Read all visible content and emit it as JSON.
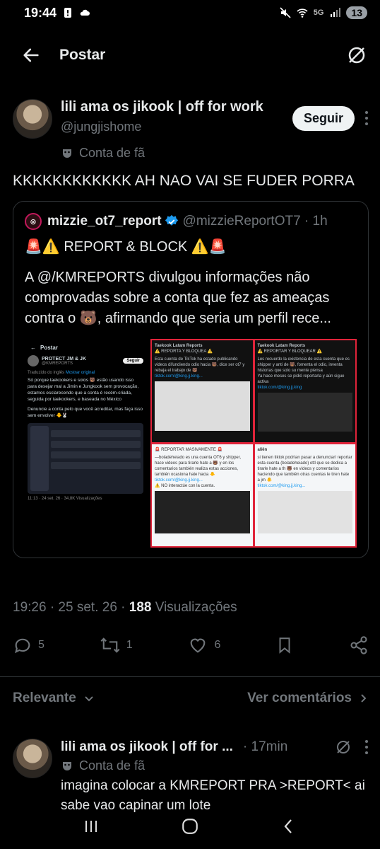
{
  "status_bar": {
    "time": "19:44",
    "battery": "13",
    "network": "5G"
  },
  "header": {
    "title": "Postar"
  },
  "post": {
    "author_name": "lili ama os jikook | off for work",
    "author_handle": "@jungjishome",
    "follow_label": "Seguir",
    "fan_label": "Conta de fã",
    "text": "KKKKKKKKKKKK AH NAO VAI SE FUDER PORRA",
    "timestamp": "19:26 · 25 set. 26 · ",
    "views_count": "188",
    "views_label": " Visualizações"
  },
  "quote": {
    "name": "mizzie_ot7_report",
    "handle": "@mizzieReportOT7 · 1h",
    "line1": "🚨⚠️ REPORT & BLOCK ⚠️🚨",
    "line2": "A @/KMREPORTS divulgou informações não comprovadas sobre a conta que fez as ameaças contra o 🐻, afirmando que seria um perfil rece...",
    "media": {
      "left_title": "Postar",
      "left_account": "PROTECT JM & JK",
      "left_handle": "@KMREPORTS",
      "left_follow": "Seguir",
      "left_translated": "Traduzido do inglês",
      "left_show_original": "Mostrar original",
      "left_body": "Só porque taekookers e solos 🐻 estão usando isso para desejar mal a Jimin e Jungkook sem provocação, estamos esclarecendo que a conta é recém-criada, seguida por taekookers, e baseada no México",
      "left_body2": "Denuncie a conta pelo que você acreditar, mas faça isso sem envolver 🐥🐰",
      "left_footer": "11:13 · 24 set. 26 · 34,8K Visualizações",
      "cell1_head": "Taekook Latam Reports",
      "cell1_tag": "⚠️ REPORTA Y BLOQUEA ⚠️",
      "cell1_text": "Esta cuenta de TikTok ha estado publicando videos difundiendo odio hacia 🐻, dice ser ot7 y rebaja el trabajo de 🐻",
      "cell1_link": "tiktok.com/@king.jj.king...",
      "cell2_head": "Taekook Latam Reports",
      "cell2_tag": "⚠️ REPORTAR Y BLOQUEAR ⚠️",
      "cell2_text": "Les recuerdo la existencia de esta cuenta que es shipper y anti de 🐻, fomenta el odio, inventa historias que solo su mente piensa",
      "cell2_text2": "Ya hace meses se pidió reportarla y aún sigue activa",
      "cell2_link": "tiktok.com/@king.jj.king",
      "cell3_tag": "🚨 REPORTAR MASIVAMENTE 🚨",
      "cell3_text": "—boladeheiado es una cuenta OT6 y shipper, hace videos para tirarle hate a 🐻 y en los comentarios también realiza estas acciones, también ocasiona hate hacia 🐥",
      "cell3_link": "tiktok.com/@king.jj.king...",
      "cell3_note": "⚠️ NO interactúe con la cuenta.",
      "cell4_head": "aliёn",
      "cell4_text": "si tienen tiktok podrían pasar a denunciar/ reportar esta cuenta (boladeheiado) ottl que se dedica a tirarle hate a th 🐻 en videos y comentarios haciendo que también otras cuentas le tiren hate a jm 🐥",
      "cell4_link": "tiktok.com/@king.jj.king..."
    }
  },
  "actions": {
    "replies": "5",
    "reposts": "1",
    "likes": "6"
  },
  "sort": {
    "label": "Relevante",
    "see_comments": "Ver comentários"
  },
  "reply": {
    "author_name": "lili ama os jikook | off for ...",
    "time": "· 17min",
    "fan_label": "Conta de fã",
    "text": "imagina colocar a KMREPORT PRA >REPORT< ai sabe vao capinar um lote"
  },
  "colors": {
    "accent": "#1d9bf0",
    "follow_bg": "#eff3f4",
    "media_border": "#e0243a",
    "muted": "#71767b"
  }
}
